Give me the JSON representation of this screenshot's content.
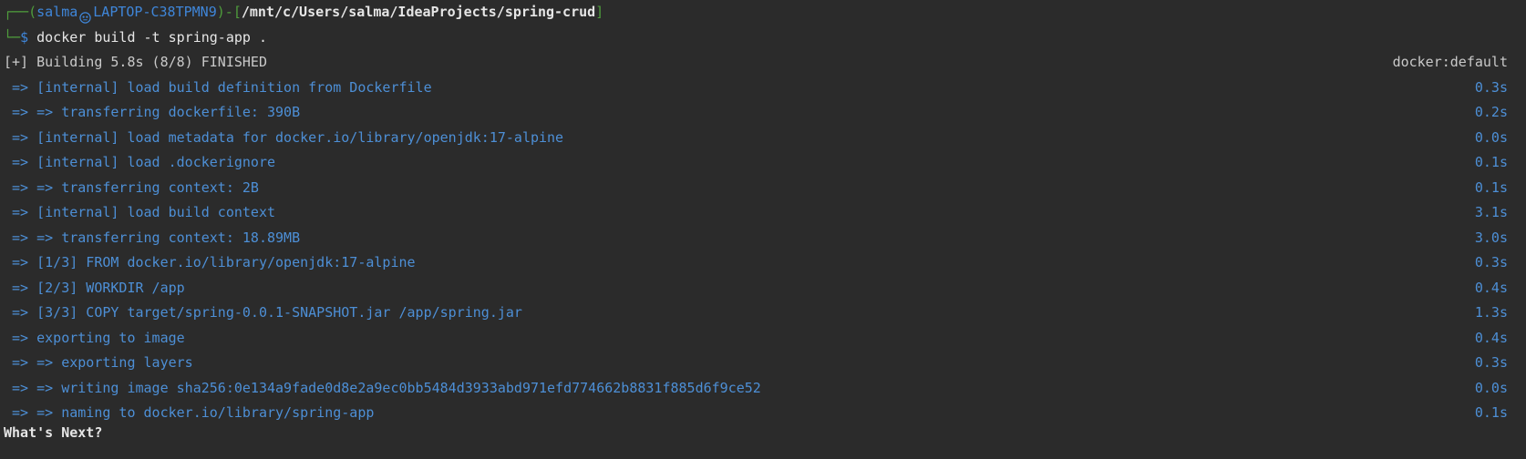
{
  "prompt": {
    "box_top_left": "┌──",
    "open_paren": "(",
    "user": "salma",
    "host": "LAPTOP-C38TPMN9",
    "close_paren_dash": ")-",
    "open_bracket": "[",
    "cwd": "/mnt/c/Users/salma/IdeaProjects/spring-crud",
    "close_bracket": "]",
    "box_bottom_left": "└─",
    "dollar": "$",
    "command": " docker build -t spring-app ."
  },
  "build_header": {
    "status": "[+] Building 5.8s (8/8) FINISHED",
    "builder": "docker:default"
  },
  "steps": [
    {
      "text": " => [internal] load build definition from Dockerfile",
      "time": "0.3s"
    },
    {
      "text": " => => transferring dockerfile: 390B",
      "time": "0.2s"
    },
    {
      "text": " => [internal] load metadata for docker.io/library/openjdk:17-alpine",
      "time": "0.0s"
    },
    {
      "text": " => [internal] load .dockerignore",
      "time": "0.1s"
    },
    {
      "text": " => => transferring context: 2B",
      "time": "0.1s"
    },
    {
      "text": " => [internal] load build context",
      "time": "3.1s"
    },
    {
      "text": " => => transferring context: 18.89MB",
      "time": "3.0s"
    },
    {
      "text": " => [1/3] FROM docker.io/library/openjdk:17-alpine",
      "time": "0.3s"
    },
    {
      "text": " => [2/3] WORKDIR /app",
      "time": "0.4s"
    },
    {
      "text": " => [3/3] COPY target/spring-0.0.1-SNAPSHOT.jar /app/spring.jar",
      "time": "1.3s"
    },
    {
      "text": " => exporting to image",
      "time": "0.4s"
    },
    {
      "text": " => => exporting layers",
      "time": "0.3s"
    },
    {
      "text": " => => writing image sha256:0e134a9fade0d8e2a9ec0bb5484d3933abd971efd774662b8831f885d6f9ce52",
      "time": "0.0s"
    },
    {
      "text": " => => naming to docker.io/library/spring-app",
      "time": "0.1s"
    }
  ],
  "trailing": "What's Next?",
  "colors": {
    "background": "#2b2b2b",
    "prompt_green": "#4f9e3c",
    "prompt_blue": "#3f86d9",
    "step_blue": "#4d8fd6"
  },
  "icons": {
    "user_host_separator": "skull-icon"
  }
}
